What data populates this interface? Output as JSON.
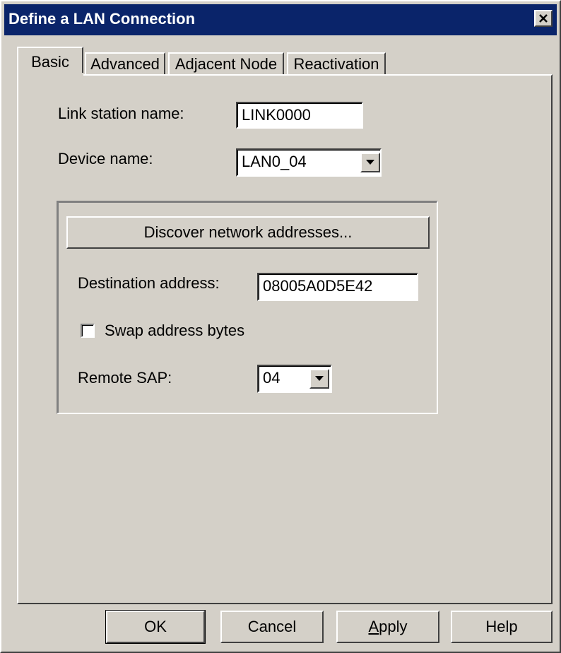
{
  "window": {
    "title": "Define a LAN Connection",
    "close_glyph": "✕"
  },
  "tabs": [
    {
      "label": "Basic",
      "active": true
    },
    {
      "label": "Advanced",
      "active": false
    },
    {
      "label": "Adjacent Node",
      "active": false
    },
    {
      "label": "Reactivation",
      "active": false
    }
  ],
  "form": {
    "link_station_label": "Link station name:",
    "link_station_value": "LINK0000",
    "device_label": "Device name:",
    "device_value": "LAN0_04",
    "discover_button": "Discover network addresses...",
    "destination_label": "Destination address:",
    "destination_value": "08005A0D5E42",
    "swap_label": "Swap address bytes",
    "swap_checked": false,
    "remote_sap_label": "Remote SAP:",
    "remote_sap_value": "04"
  },
  "buttons": {
    "ok": "OK",
    "cancel": "Cancel",
    "apply_first": "A",
    "apply_rest": "pply",
    "help": "Help"
  },
  "icons": {
    "close": "close-icon",
    "dropdown": "chevron-down-icon"
  },
  "colors": {
    "titlebar": "#0a246a",
    "face": "#d4d0c8"
  }
}
